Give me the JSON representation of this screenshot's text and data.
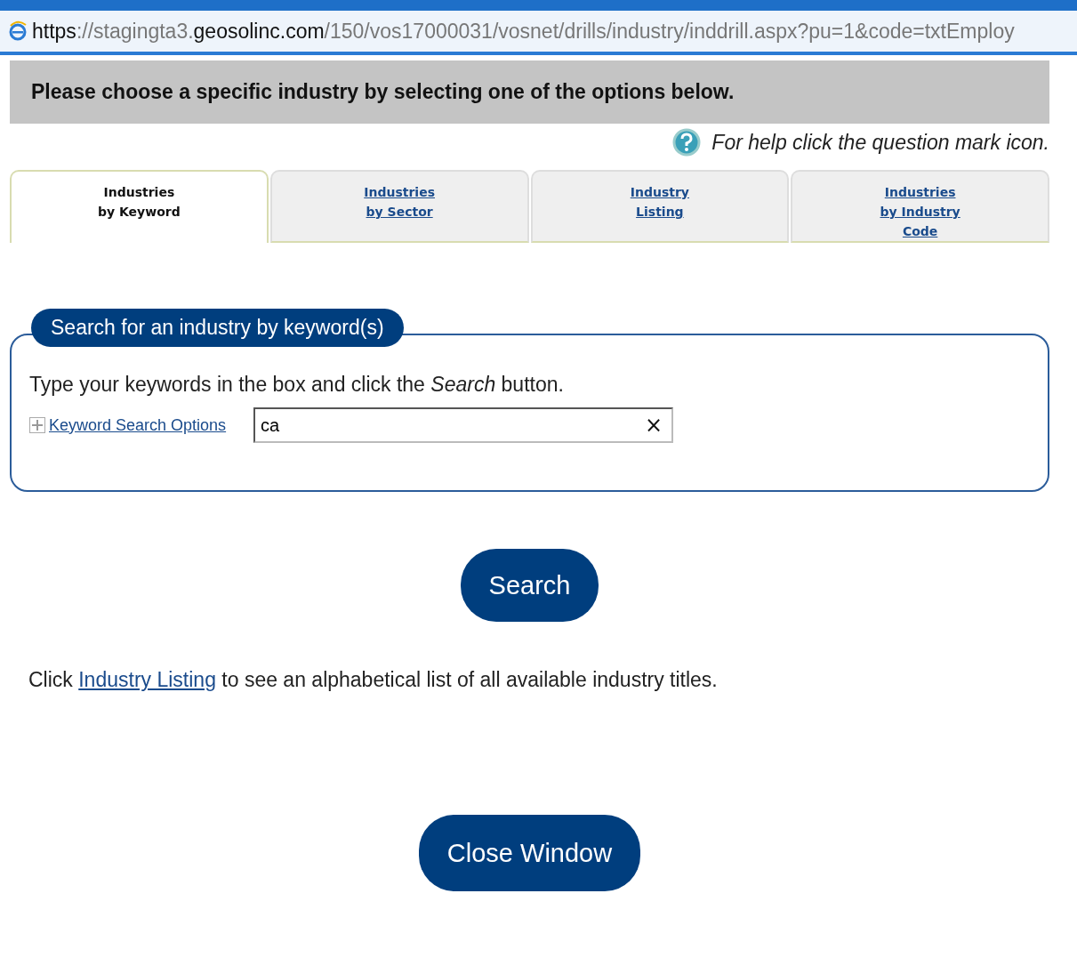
{
  "address_bar": {
    "url_parts": [
      {
        "text": "https",
        "strong": true
      },
      {
        "text": "://stagingta3.",
        "strong": false
      },
      {
        "text": "geosolinc.com",
        "strong": true
      },
      {
        "text": "/150/vos17000031/vosnet/drills/industry/inddrill.aspx?pu=1&code=txtEmploy",
        "strong": false
      }
    ]
  },
  "header": {
    "title": "Please choose a specific industry by selecting one of the options below.",
    "help": "For help click the question mark icon."
  },
  "tabs": [
    {
      "lines": [
        "Industries",
        "by Keyword"
      ],
      "selected": true
    },
    {
      "lines": [
        "Industries",
        "by Sector"
      ],
      "selected": false
    },
    {
      "lines": [
        "Industry",
        "Listing"
      ],
      "selected": false
    },
    {
      "lines": [
        "Industries",
        "by Industry",
        "Code"
      ],
      "selected": false
    }
  ],
  "search_panel": {
    "legend": "Search for an industry by keyword(s)",
    "instructions": "Type your keywords in the box and click the *Search* button.",
    "options_link": "Keyword Search Options",
    "options_expanded": false,
    "keyword_value": "ca",
    "clear": "×"
  },
  "search_button": "Search",
  "listing_note": {
    "before": "Click ",
    "link": "Industry Listing",
    "after": " to see an alphabetical list of all available industry titles."
  },
  "close_button": "Close Window"
}
